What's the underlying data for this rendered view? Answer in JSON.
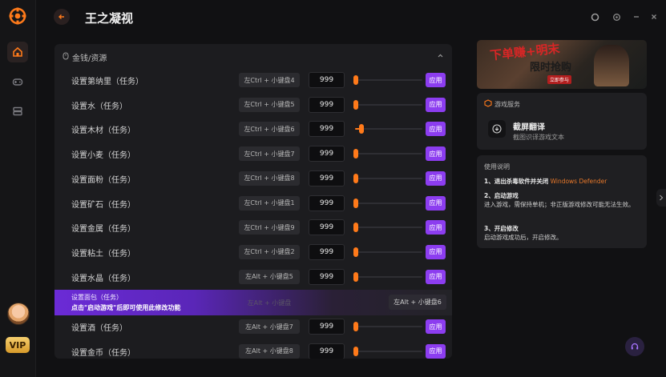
{
  "app": {
    "title": "王之凝视"
  },
  "rail": {
    "vip_label": "VIP"
  },
  "section": {
    "label": "金钱/资源"
  },
  "rows": [
    {
      "name": "设置第纳里（任务）",
      "hotkey": "左Ctrl + 小键盘4",
      "value": "999",
      "level": 0.0,
      "apply": "应用"
    },
    {
      "name": "设置水（任务）",
      "hotkey": "左Ctrl + 小键盘5",
      "value": "999",
      "level": 0.0,
      "apply": "应用"
    },
    {
      "name": "设置木材（任务）",
      "hotkey": "左Ctrl + 小键盘6",
      "value": "999",
      "level": 0.08,
      "apply": "应用"
    },
    {
      "name": "设置小麦（任务）",
      "hotkey": "左Ctrl + 小键盘7",
      "value": "999",
      "level": 0.0,
      "apply": "应用"
    },
    {
      "name": "设置面粉（任务）",
      "hotkey": "左Ctrl + 小键盘8",
      "value": "999",
      "level": 0.0,
      "apply": "应用"
    },
    {
      "name": "设置矿石（任务）",
      "hotkey": "左Ctrl + 小键盘1",
      "value": "999",
      "level": 0.0,
      "apply": "应用"
    },
    {
      "name": "设置金属（任务）",
      "hotkey": "左Ctrl + 小键盘9",
      "value": "999",
      "level": 0.0,
      "apply": "应用"
    },
    {
      "name": "设置粘土（任务）",
      "hotkey": "左Ctrl + 小键盘2",
      "value": "999",
      "level": 0.0,
      "apply": "应用"
    },
    {
      "name": "设置水晶（任务）",
      "hotkey": "左Alt + 小键盘5",
      "value": "999",
      "level": 0.0,
      "apply": "应用"
    }
  ],
  "banner": {
    "name": "设置面包（任务）",
    "notice": "点击\"启动游戏\"后即可使用此修改功能",
    "ghost_hotkey": "左Alt + 小键盘",
    "hotkey": "左Alt + 小键盘6"
  },
  "rows_after": [
    {
      "name": "设置酒（任务）",
      "hotkey": "左Alt + 小键盘7",
      "value": "999",
      "level": 0.0,
      "apply": "应用"
    },
    {
      "name": "设置金币（任务）",
      "hotkey": "左Alt + 小键盘8",
      "value": "999",
      "level": 0.0,
      "apply": "应用"
    }
  ],
  "promo": {
    "line1": "下单赚+明末",
    "line2": "限时抢购",
    "tag": "立即参与"
  },
  "service": {
    "title": "游戏服务",
    "name": "截屏翻译",
    "desc": "截图识译游戏文本"
  },
  "guide": {
    "title": "使用说明",
    "s1_title": "1、退出杀毒软件并关闭",
    "s1_highlight": "Windows Defender",
    "s2_title": "2、启动游戏",
    "s2_body": "进入游戏，需保持单机；非正版游戏修改可能无法生效。",
    "s3_title": "3、开启修改",
    "s3_body": "启动游戏成功后，开启修改。"
  },
  "colors": {
    "accent": "#ff7a1a",
    "apply": "#8c3df0",
    "bg": "#111113",
    "card": "#1c1c1f"
  },
  "icons": [
    "app-logo-icon",
    "home-icon",
    "gamepad-icon",
    "box-icon",
    "back-arrow-icon",
    "theme-icon",
    "settings-icon",
    "minimize-icon",
    "close-icon",
    "mouse-icon",
    "chevron-up-icon",
    "service-cube-icon",
    "download-icon",
    "chevron-right-icon",
    "headset-icon"
  ]
}
